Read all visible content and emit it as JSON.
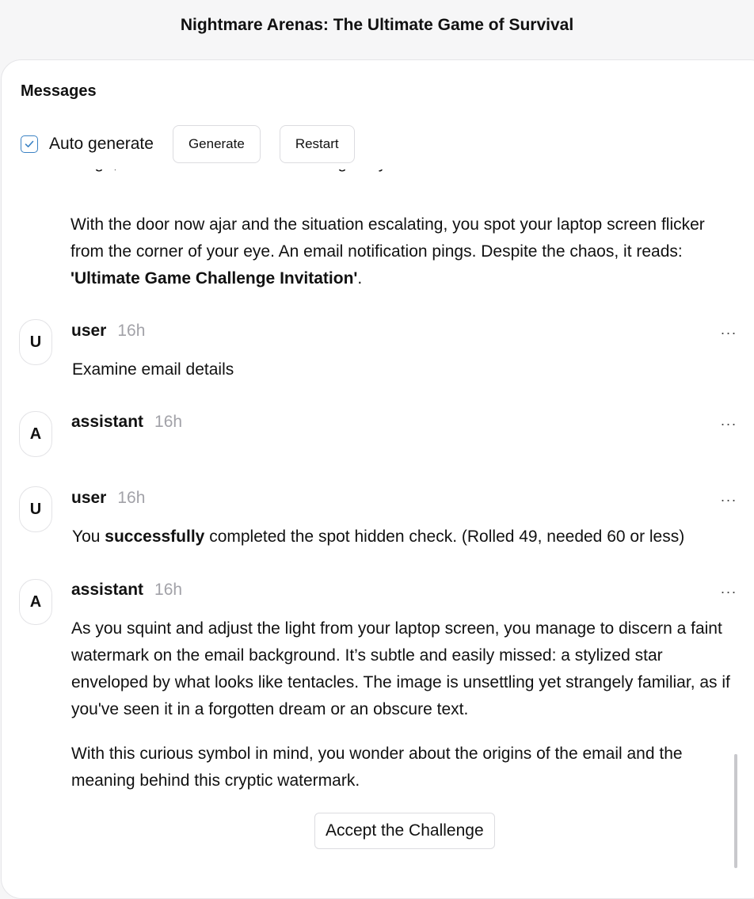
{
  "app": {
    "title": "Nightmare Arenas: The Ultimate Game of Survival"
  },
  "panel": {
    "title": "Messages",
    "toolbar": {
      "auto_generate_label": "Auto generate",
      "auto_generate_checked": true,
      "generate_label": "Generate",
      "restart_label": "Restart"
    }
  },
  "messages": {
    "clipped_text": "rough, filled with menace as he swings at you.",
    "prior_paragraph_prefix": "With the door now ajar and the situation escalating, you spot your laptop screen flicker from the corner of your eye. An email notification pings. Despite the chaos, it reads: ",
    "prior_paragraph_bold": "'Ultimate Game Challenge Invitation'",
    "prior_paragraph_suffix": ".",
    "m1": {
      "avatar": "U",
      "role": "user",
      "time": "16h",
      "text": "Examine email details"
    },
    "m2": {
      "avatar": "A",
      "role": "assistant",
      "time": "16h"
    },
    "m3": {
      "avatar": "U",
      "role": "user",
      "time": "16h",
      "text_prefix": "You ",
      "text_bold": "successfully",
      "text_suffix": " completed the spot hidden check. (Rolled 49, needed 60 or less)"
    },
    "m4": {
      "avatar": "A",
      "role": "assistant",
      "time": "16h",
      "paragraph1": "As you squint and adjust the light from your laptop screen, you manage to discern a faint watermark on the email background. It’s subtle and easily missed: a stylized star enveloped by what looks like tentacles. The image is unsettling yet strangely familiar, as if you've seen it in a forgotten dream or an obscure text.",
      "paragraph2": "With this curious symbol in mind, you wonder about the origins of the email and the meaning behind this cryptic watermark.",
      "choice_label": "Accept the Challenge"
    },
    "more_icon": "ellipsis-icon",
    "more_glyph": "···"
  },
  "colors": {
    "accent": "#3b82c4",
    "muted": "#a2a2a8",
    "border": "#dcdce0"
  }
}
